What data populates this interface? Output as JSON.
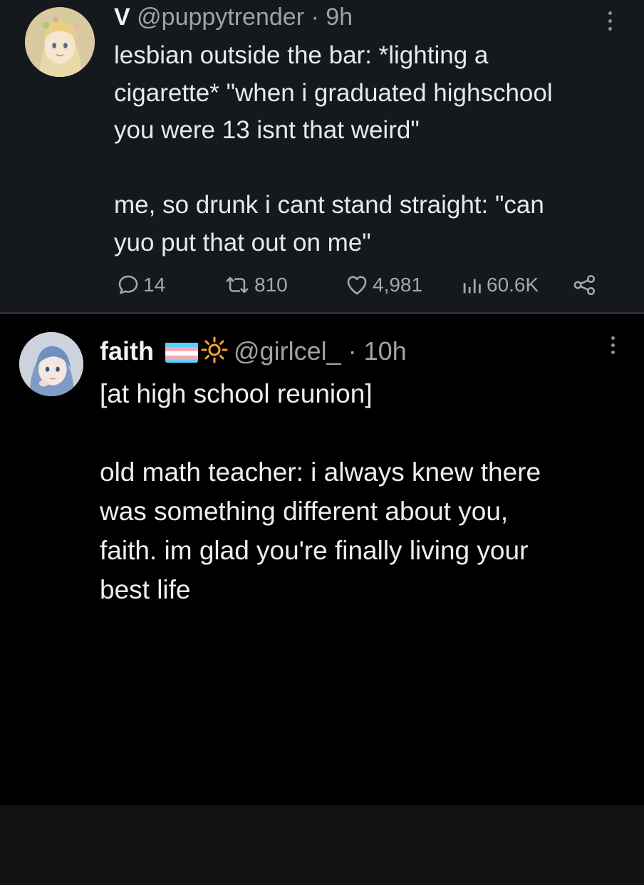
{
  "tweet1": {
    "display_name": "V",
    "handle": "@puppytrender",
    "separator": "·",
    "time": "9h",
    "text": "lesbian outside the bar: *lighting a\ncigarette* \"when i graduated highschool\nyou were 13 isnt that weird\"\n\nme, so drunk i cant stand straight: \"can\nyuo put that out on me\"",
    "replies": "14",
    "reposts": "810",
    "likes": "4,981",
    "views": "60.6K"
  },
  "tweet2": {
    "display_name": "faith",
    "handle": "@girlcel_",
    "separator": "·",
    "time": "10h",
    "text": "[at high school reunion]\n\nold math teacher: i always knew there\nwas something different about you,\nfaith. im glad you're finally living your\nbest life"
  },
  "colors": {
    "tweet1_background": "#15181c",
    "page_background": "#000000",
    "footer_background": "#111214",
    "secondary_text": "#9ea3a8",
    "primary_text": "#e7e9ea"
  },
  "icons": [
    "kebab-menu-icon",
    "reply-icon",
    "repost-icon",
    "like-icon",
    "views-icon",
    "share-icon",
    "trans-flag-icon",
    "sun-icon"
  ]
}
